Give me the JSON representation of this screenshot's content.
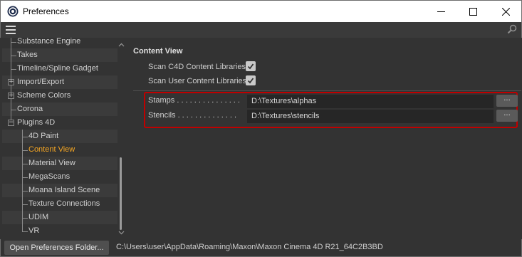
{
  "window": {
    "title": "Preferences",
    "app_icon": "cinema4d-logo-icon",
    "controls": [
      "minimize-icon",
      "maximize-icon",
      "close-icon"
    ]
  },
  "menubar": {
    "menu_icon": "hamburger-menu-icon",
    "search_icon": "search-icon"
  },
  "sidebar": {
    "items": [
      {
        "label": "Substance Engine",
        "level": 0,
        "expander": "",
        "active": false
      },
      {
        "label": "Takes",
        "level": 0,
        "expander": "",
        "active": false
      },
      {
        "label": "Timeline/Spline Gadget",
        "level": 0,
        "expander": "",
        "active": false
      },
      {
        "label": "Import/Export",
        "level": 0,
        "expander": "+",
        "active": false
      },
      {
        "label": "Scheme Colors",
        "level": 0,
        "expander": "+",
        "active": false
      },
      {
        "label": "Corona",
        "level": 0,
        "expander": "",
        "active": false
      },
      {
        "label": "Plugins 4D",
        "level": 0,
        "expander": "−",
        "active": false
      },
      {
        "label": "4D Paint",
        "level": 1,
        "expander": "",
        "active": false
      },
      {
        "label": "Content View",
        "level": 1,
        "expander": "",
        "active": true
      },
      {
        "label": "Material View",
        "level": 1,
        "expander": "",
        "active": false
      },
      {
        "label": "MegaScans",
        "level": 1,
        "expander": "",
        "active": false
      },
      {
        "label": "Moana Island Scene",
        "level": 1,
        "expander": "",
        "active": false
      },
      {
        "label": "Texture Connections",
        "level": 1,
        "expander": "",
        "active": false
      },
      {
        "label": "UDIM",
        "level": 1,
        "expander": "",
        "active": false
      },
      {
        "label": "VR",
        "level": 1,
        "expander": "",
        "active": false
      }
    ],
    "active_color": "#f5a623"
  },
  "main": {
    "section_title": "Content View",
    "checkboxes": [
      {
        "label": "Scan C4D Content Libraries",
        "checked": true
      },
      {
        "label": "Scan User Content Libraries",
        "checked": true
      }
    ],
    "paths": [
      {
        "label": "Stamps . . . . . . . . . . . . . . .",
        "value": "D:\\Textures\\alphas",
        "button": "..."
      },
      {
        "label": "Stencils . . . . . . . . . . . . . .",
        "value": "D:\\Textures\\stencils",
        "button": "..."
      }
    ],
    "highlight_color": "#c00000"
  },
  "bottom": {
    "open_button_label": "Open Preferences Folder...",
    "prefs_path": "C:\\Users\\user\\AppData\\Roaming\\Maxon\\Maxon Cinema 4D R21_64C2B3BD"
  }
}
